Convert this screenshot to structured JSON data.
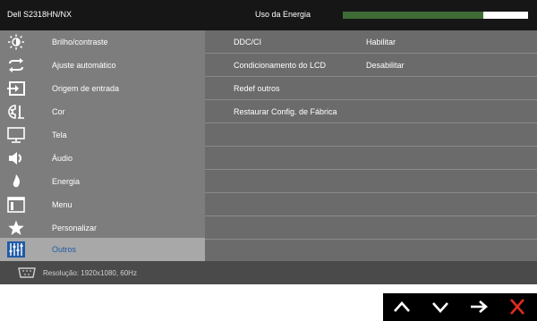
{
  "header": {
    "model": "Dell S2318HN/NX",
    "energy_label": "Uso da Energia",
    "energy_level": 0.76,
    "colors": {
      "bar_fill": "#3f6b37",
      "bar_bg": "#ffffff",
      "background": "#161616"
    }
  },
  "sidebar": {
    "items": [
      {
        "label": "Brilho/contraste",
        "icon": "brightness-icon"
      },
      {
        "label": "Ajuste automático",
        "icon": "auto-adjust-icon"
      },
      {
        "label": "Origem de entrada",
        "icon": "input-source-icon"
      },
      {
        "label": "Cor",
        "icon": "color-icon"
      },
      {
        "label": "Tela",
        "icon": "display-icon"
      },
      {
        "label": "Áudio",
        "icon": "speaker-icon"
      },
      {
        "label": "Energia",
        "icon": "power-icon"
      },
      {
        "label": "Menu",
        "icon": "menu-icon"
      },
      {
        "label": "Personalizar",
        "icon": "star-icon"
      },
      {
        "label": "Outros",
        "icon": "sliders-icon"
      }
    ],
    "active_label": "Outros",
    "active_color": "#1f5aa8"
  },
  "content": {
    "rows": [
      {
        "label": "DDC/CI",
        "value": "Habilitar"
      },
      {
        "label": "Condicionamento do LCD",
        "value": "Desabilitar"
      },
      {
        "label": "Redef outros",
        "value": ""
      },
      {
        "label": "Restaurar Config. de Fábrica",
        "value": ""
      },
      {
        "label": "",
        "value": ""
      },
      {
        "label": "",
        "value": ""
      },
      {
        "label": "",
        "value": ""
      },
      {
        "label": "",
        "value": ""
      },
      {
        "label": "",
        "value": ""
      },
      {
        "label": "",
        "value": ""
      }
    ]
  },
  "footer": {
    "resolution": "Resolução: 1920x1080, 60Hz",
    "icon": "vga-connector-icon"
  },
  "nav": {
    "buttons": [
      {
        "icon": "up-arrow-icon"
      },
      {
        "icon": "down-arrow-icon"
      },
      {
        "icon": "right-arrow-icon"
      },
      {
        "icon": "close-icon",
        "color": "#e02b20"
      }
    ]
  }
}
